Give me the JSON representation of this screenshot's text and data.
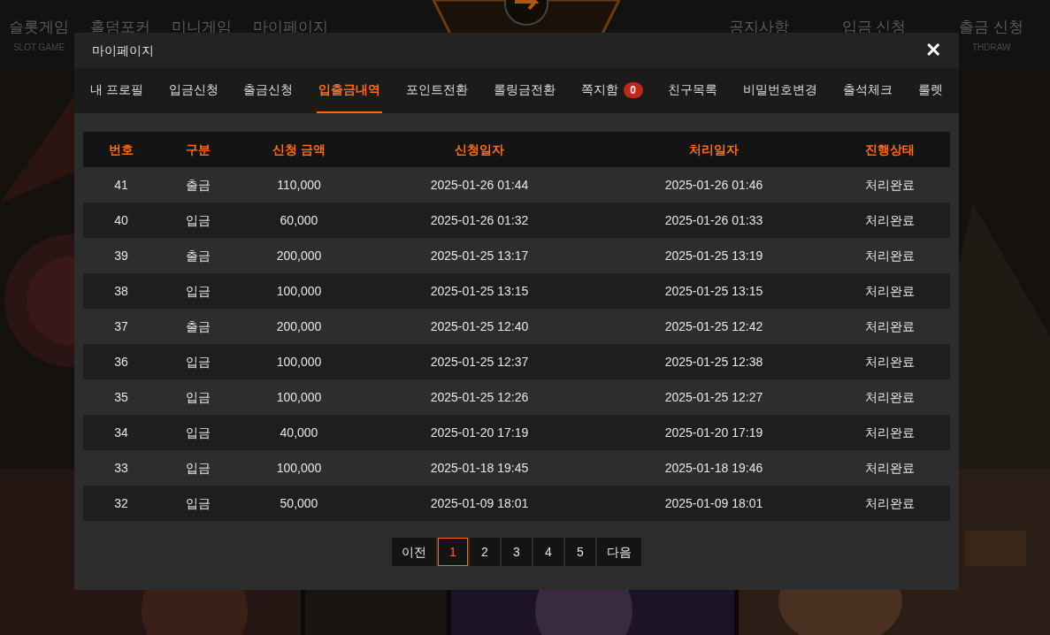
{
  "background_nav": {
    "left": [
      {
        "label": "슬롯게임",
        "sublabel": "SLOT GAME"
      },
      {
        "label": "홀덤포커"
      },
      {
        "label": "미니게임"
      },
      {
        "label": "마이페이지"
      }
    ],
    "right": [
      {
        "label": "공지사항"
      },
      {
        "label": "입금 신청"
      },
      {
        "label": "출금 신청",
        "sublabel": "THDRAW"
      }
    ]
  },
  "modal": {
    "title": "마이페이지",
    "close": "✕",
    "tabs": [
      {
        "label": "내 프로필",
        "selected": false
      },
      {
        "label": "입금신청",
        "selected": false
      },
      {
        "label": "출금신청",
        "selected": false
      },
      {
        "label": "입출금내역",
        "selected": true
      },
      {
        "label": "포인트전환",
        "selected": false
      },
      {
        "label": "롤링금전환",
        "selected": false
      },
      {
        "label": "쪽지함",
        "badge": "0",
        "selected": false
      },
      {
        "label": "친구목록",
        "selected": false
      },
      {
        "label": "비밀번호변경",
        "selected": false
      },
      {
        "label": "출석체크",
        "selected": false
      },
      {
        "label": "룰렛",
        "selected": false
      }
    ],
    "table": {
      "columns": [
        "번호",
        "구분",
        "신청 금액",
        "신청일자",
        "처리일자",
        "진행상태"
      ],
      "rows": [
        [
          "41",
          "출금",
          "110,000",
          "2025-01-26 01:44",
          "2025-01-26 01:46",
          "처리완료"
        ],
        [
          "40",
          "입금",
          "60,000",
          "2025-01-26 01:32",
          "2025-01-26 01:33",
          "처리완료"
        ],
        [
          "39",
          "출금",
          "200,000",
          "2025-01-25 13:17",
          "2025-01-25 13:19",
          "처리완료"
        ],
        [
          "38",
          "입금",
          "100,000",
          "2025-01-25 13:15",
          "2025-01-25 13:15",
          "처리완료"
        ],
        [
          "37",
          "출금",
          "200,000",
          "2025-01-25 12:40",
          "2025-01-25 12:42",
          "처리완료"
        ],
        [
          "36",
          "입금",
          "100,000",
          "2025-01-25 12:37",
          "2025-01-25 12:38",
          "처리완료"
        ],
        [
          "35",
          "입금",
          "100,000",
          "2025-01-25 12:26",
          "2025-01-25 12:27",
          "처리완료"
        ],
        [
          "34",
          "입금",
          "40,000",
          "2025-01-20 17:19",
          "2025-01-20 17:19",
          "처리완료"
        ],
        [
          "33",
          "입금",
          "100,000",
          "2025-01-18 19:45",
          "2025-01-18 19:46",
          "처리완료"
        ],
        [
          "32",
          "입금",
          "50,000",
          "2025-01-09 18:01",
          "2025-01-09 18:01",
          "처리완료"
        ]
      ]
    },
    "pagination": {
      "prev": "이전",
      "next": "다음",
      "pages": [
        {
          "label": "1",
          "selected": true
        },
        {
          "label": "2",
          "selected": false
        },
        {
          "label": "3",
          "selected": false
        },
        {
          "label": "4",
          "selected": false
        },
        {
          "label": "5",
          "selected": false
        }
      ]
    }
  }
}
